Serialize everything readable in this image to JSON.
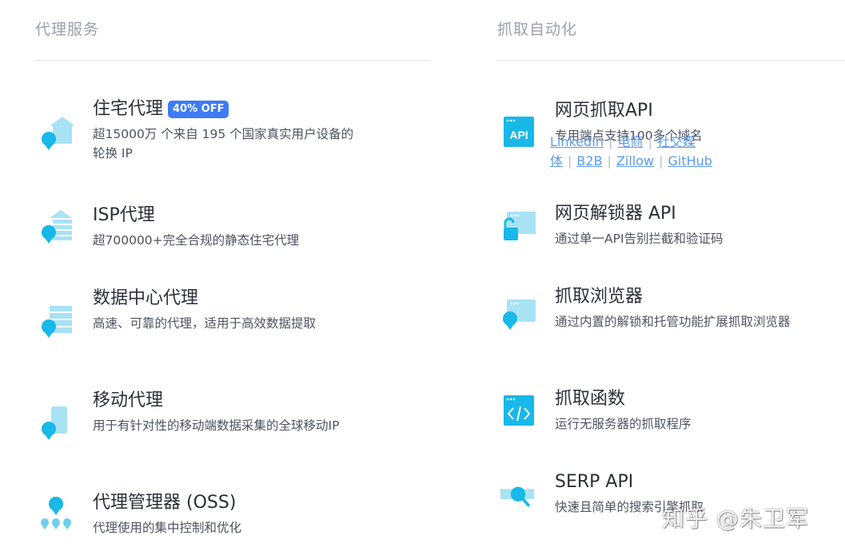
{
  "colors": {
    "accent_cyan": "#18b8e8",
    "light_cyan": "#a8e2f5",
    "badge_blue": "#3d7bf7",
    "link_blue": "#5b9bf0"
  },
  "proxy": {
    "section_title": "代理服务",
    "items": [
      {
        "title": "住宅代理",
        "badge": "40% OFF",
        "desc": "超15000万 个来自 195 个国家真实用户设备的轮换 IP",
        "icon": "residential-proxy-icon"
      },
      {
        "title": "ISP代理",
        "desc": "超700000+完全合规的静态住宅代理",
        "icon": "isp-proxy-icon"
      },
      {
        "title": "数据中心代理",
        "desc": "高速、可靠的代理，适用于高效数据提取",
        "icon": "datacenter-proxy-icon"
      },
      {
        "title": "移动代理",
        "desc": "用于有针对性的移动端数据采集的全球移动IP",
        "icon": "mobile-proxy-icon"
      },
      {
        "title": "代理管理器 (OSS)",
        "desc": "代理使用的集中控制和优化",
        "icon": "proxy-manager-icon"
      }
    ]
  },
  "scraping": {
    "section_title": "抓取自动化",
    "items": [
      {
        "title": "网页抓取API",
        "desc": "专用端点支持100多个域名",
        "icon": "api-icon",
        "links": [
          "LinkedIn",
          "电商",
          "社交媒体",
          "B2B",
          "Zillow",
          "GitHub"
        ]
      },
      {
        "title": "网页解锁器 API",
        "desc": "通过单一API告别拦截和验证码",
        "icon": "unlocker-icon"
      },
      {
        "title": "抓取浏览器",
        "desc": "通过内置的解锁和托管功能扩展抓取浏览器",
        "icon": "scraping-browser-icon"
      },
      {
        "title": "抓取函数",
        "desc": "运行无服务器的抓取程序",
        "icon": "code-function-icon"
      },
      {
        "title": "SERP API",
        "desc": "快速且简单的搜索引擎抓取",
        "icon": "serp-search-icon"
      }
    ]
  },
  "watermark": "知乎 @朱卫军"
}
